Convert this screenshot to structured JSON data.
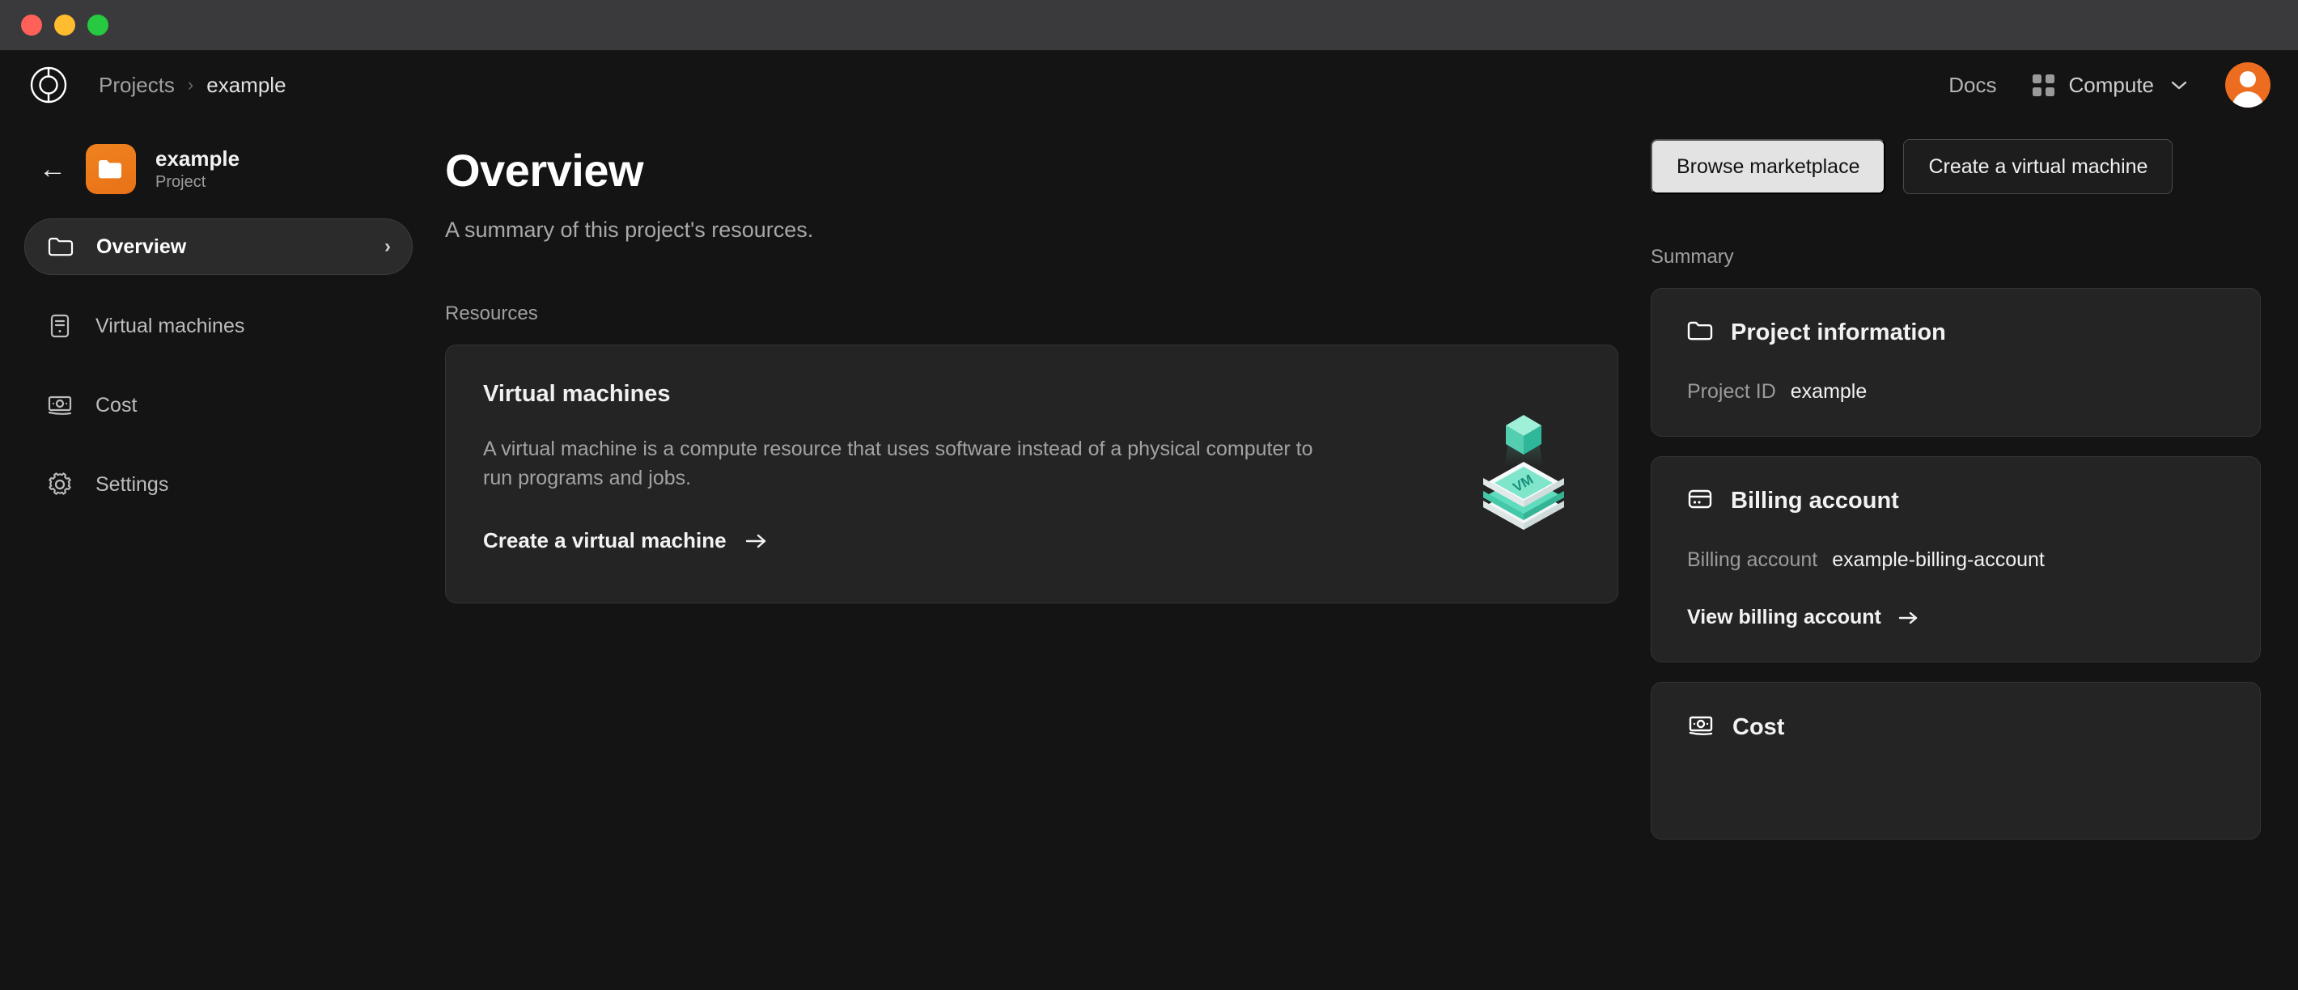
{
  "window": {
    "controls": [
      "close",
      "minimize",
      "zoom"
    ],
    "colors": {
      "close": "#ff6158",
      "minimize": "#febc2e",
      "zoom": "#26c940",
      "titlebar": "#3a3a3c"
    }
  },
  "topbar": {
    "logo": "oxide-logo-icon",
    "breadcrumb": {
      "root": "Projects",
      "separator": "›",
      "current": "example"
    },
    "docs_label": "Docs",
    "system_picker": {
      "label": "Compute",
      "chevron": "⌄"
    },
    "avatar": "user-avatar"
  },
  "sidebar": {
    "back": "←",
    "project": {
      "name": "example",
      "type": "Project"
    },
    "items": [
      {
        "label": "Overview",
        "icon": "folder-icon",
        "active": true,
        "chevron": "›"
      },
      {
        "label": "Virtual machines",
        "icon": "server-icon",
        "active": false
      },
      {
        "label": "Cost",
        "icon": "money-icon",
        "active": false
      },
      {
        "label": "Settings",
        "icon": "gear-icon",
        "active": false
      }
    ]
  },
  "main": {
    "title": "Overview",
    "subtitle": "A summary of this project's resources.",
    "resources_label": "Resources",
    "resource_card": {
      "title": "Virtual machines",
      "description": "A virtual machine is a compute resource that uses software instead of a physical computer to run programs and jobs.",
      "cta": "Create a virtual machine",
      "cta_arrow": "→",
      "art": {
        "name": "vm-stack-illustration",
        "label": "VM",
        "accent": "#6fe3c4"
      }
    }
  },
  "actions": {
    "browse_marketplace": "Browse marketplace",
    "create_vm": "Create a virtual machine"
  },
  "summary": {
    "label": "Summary",
    "cards": [
      {
        "title": "Project information",
        "icon": "folder-icon",
        "rows": [
          {
            "key": "Project ID",
            "value": "example"
          }
        ]
      },
      {
        "title": "Billing account",
        "icon": "credit-card-icon",
        "rows": [
          {
            "key": "Billing account",
            "value": "example-billing-account"
          }
        ],
        "cta": "View billing account",
        "cta_arrow": "→"
      },
      {
        "title": "Cost",
        "icon": "money-icon",
        "rows": []
      }
    ]
  },
  "theme": {
    "background": "#141414",
    "card": "#242424",
    "border": "#343434",
    "accent_orange": "#ed6d20",
    "accent_teal": "#6fe3c4",
    "text_primary": "#f2f2f2",
    "text_secondary": "#a0a0a0"
  }
}
